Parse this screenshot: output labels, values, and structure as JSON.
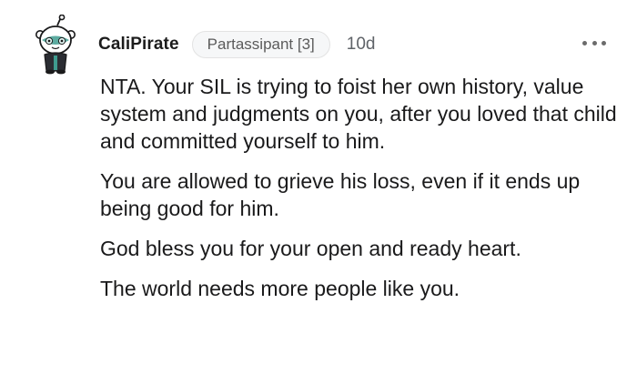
{
  "comment": {
    "author": "CaliPirate",
    "flair": "Partassipant [3]",
    "age": "10d",
    "paragraphs": [
      "NTA. Your SIL is trying to foist her own history, value system and judgments on you, after you loved that child and committed yourself to him.",
      "You are allowed to grieve his loss, even if it ends up being good for him.",
      "God bless you for your open and ready heart.",
      "The world needs more people like you."
    ]
  },
  "icons": {
    "avatar": "snoo-avatar-icon",
    "more": "more-options-icon"
  },
  "colors": {
    "avatar_face": "#3f9c8f",
    "text": "#1a1a1b",
    "meta": "#5f6368"
  }
}
